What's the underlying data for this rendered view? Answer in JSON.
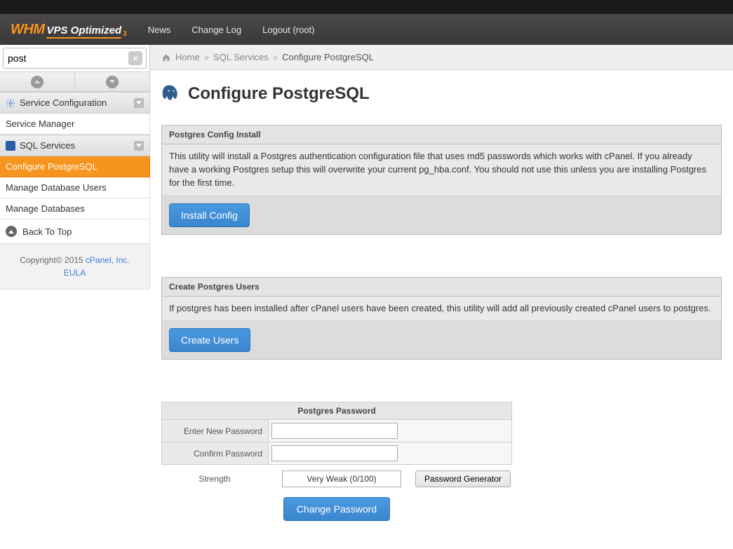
{
  "logo": {
    "whm": "WHM",
    "vps": "VPS Optimized",
    "suffix": "3"
  },
  "nav": {
    "news": "News",
    "changelog": "Change Log",
    "logout": "Logout (root)"
  },
  "search": {
    "value": "post",
    "clear": "×"
  },
  "sidebar": {
    "service_config": {
      "label": "Service Configuration",
      "items": [
        "Service Manager"
      ]
    },
    "sql_services": {
      "label": "SQL Services",
      "items": [
        "Configure PostgreSQL",
        "Manage Database Users",
        "Manage Databases"
      ],
      "active_index": 0
    },
    "back_top": "Back To Top",
    "copyright_prefix": "Copyright© 2015 ",
    "cpanel_link": "cPanel, Inc.",
    "eula": "EULA"
  },
  "breadcrumb": {
    "home": "Home",
    "sql": "SQL Services",
    "current": "Configure PostgreSQL"
  },
  "page_title": "Configure PostgreSQL",
  "panel1": {
    "head": "Postgres Config Install",
    "body": "This utility will install a Postgres authentication configuration file that uses md5 passwords which works with cPanel. If you already have a working Postgres setup this will overwrite your current pg_hba.conf. You should not use this unless you are installing Postgres for the first time.",
    "button": "Install Config"
  },
  "panel2": {
    "head": "Create Postgres Users",
    "body": "If postgres has been installed after cPanel users have been created, this utility will add all previously created cPanel users to postgres.",
    "button": "Create Users"
  },
  "pw": {
    "section_title": "Postgres Password",
    "enter_label": "Enter New Password",
    "confirm_label": "Confirm Password",
    "strength_label": "Strength",
    "strength_value": "Very Weak (0/100)",
    "generator": "Password Generator",
    "change": "Change Password"
  }
}
